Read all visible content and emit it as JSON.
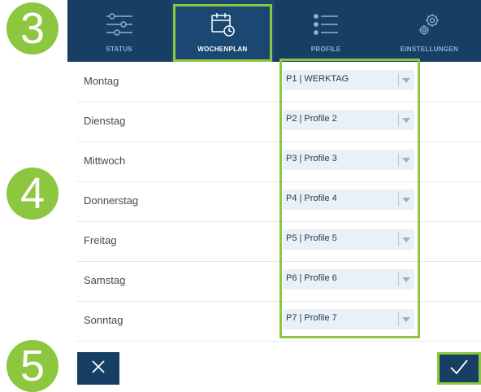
{
  "badges": {
    "b3": "3",
    "b4": "4",
    "b5": "5"
  },
  "nav": {
    "tabs": [
      {
        "label": "STATUS",
        "icon": "sliders-icon",
        "active": false
      },
      {
        "label": "WOCHENPLAN",
        "icon": "calendar-clock-icon",
        "active": true
      },
      {
        "label": "PROFILE",
        "icon": "list-icon",
        "active": false
      },
      {
        "label": "EINSTELLUNGEN",
        "icon": "gears-icon",
        "active": false
      }
    ]
  },
  "schedule": {
    "rows": [
      {
        "day": "Montag",
        "profile": "P1 | WERKTAG"
      },
      {
        "day": "Dienstag",
        "profile": "P2 | Profile 2"
      },
      {
        "day": "Mittwoch",
        "profile": "P3 | Profile 3"
      },
      {
        "day": "Donnerstag",
        "profile": "P4 | Profile 4"
      },
      {
        "day": "Freitag",
        "profile": "P5 | Profile 5"
      },
      {
        "day": "Samstag",
        "profile": "P6 | Profile 6"
      },
      {
        "day": "Sonntag",
        "profile": "P7 | Profile 7"
      }
    ]
  },
  "actions": {
    "cancel": "cancel",
    "confirm": "confirm"
  },
  "colors": {
    "nav_bg": "#163f63",
    "accent_green": "#8dc63f",
    "select_bg": "#e8f1f8"
  }
}
